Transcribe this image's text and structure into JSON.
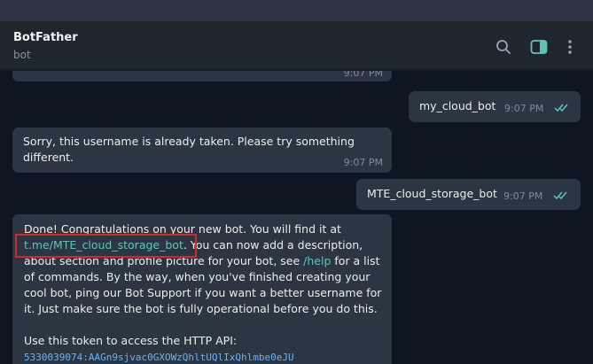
{
  "header": {
    "title": "BotFather",
    "subtitle": "bot"
  },
  "messages": [
    {
      "direction": "in",
      "text": "",
      "time": "9:07 PM"
    },
    {
      "direction": "out",
      "text": "my_cloud_bot",
      "time": "9:07 PM",
      "read": true
    },
    {
      "direction": "in",
      "text": "Sorry, this username is already taken. Please try something different.",
      "time": "9:07 PM"
    },
    {
      "direction": "out",
      "text": "MTE_cloud_storage_bot",
      "time": "9:07 PM",
      "read": true
    }
  ],
  "done_message": {
    "line1": "Done! Congratulations on your new bot. You will find it at",
    "link": "t.me/MTE_cloud_storage_bot",
    "after_link": ". You can now add a description, about section and profile picture for your bot, see ",
    "help": "/help",
    "rest": " for a list of commands. By the way, when you've finished creating your cool bot, ping our Bot Support if you want a better username for it. Just make sure the bot is fully operational before you do this.",
    "token_label": "Use this token to access the HTTP API:",
    "token": "5330039074:AAGn9sjvac0GXOWzQhltUQlIxQhlmbe0eJU"
  },
  "icons": {
    "search": "search-icon",
    "sidebar": "sidebar-toggle-icon",
    "menu": "more-vertical-icon"
  },
  "colors": {
    "accent": "#5ec4b6",
    "highlight_box": "#d62828"
  }
}
